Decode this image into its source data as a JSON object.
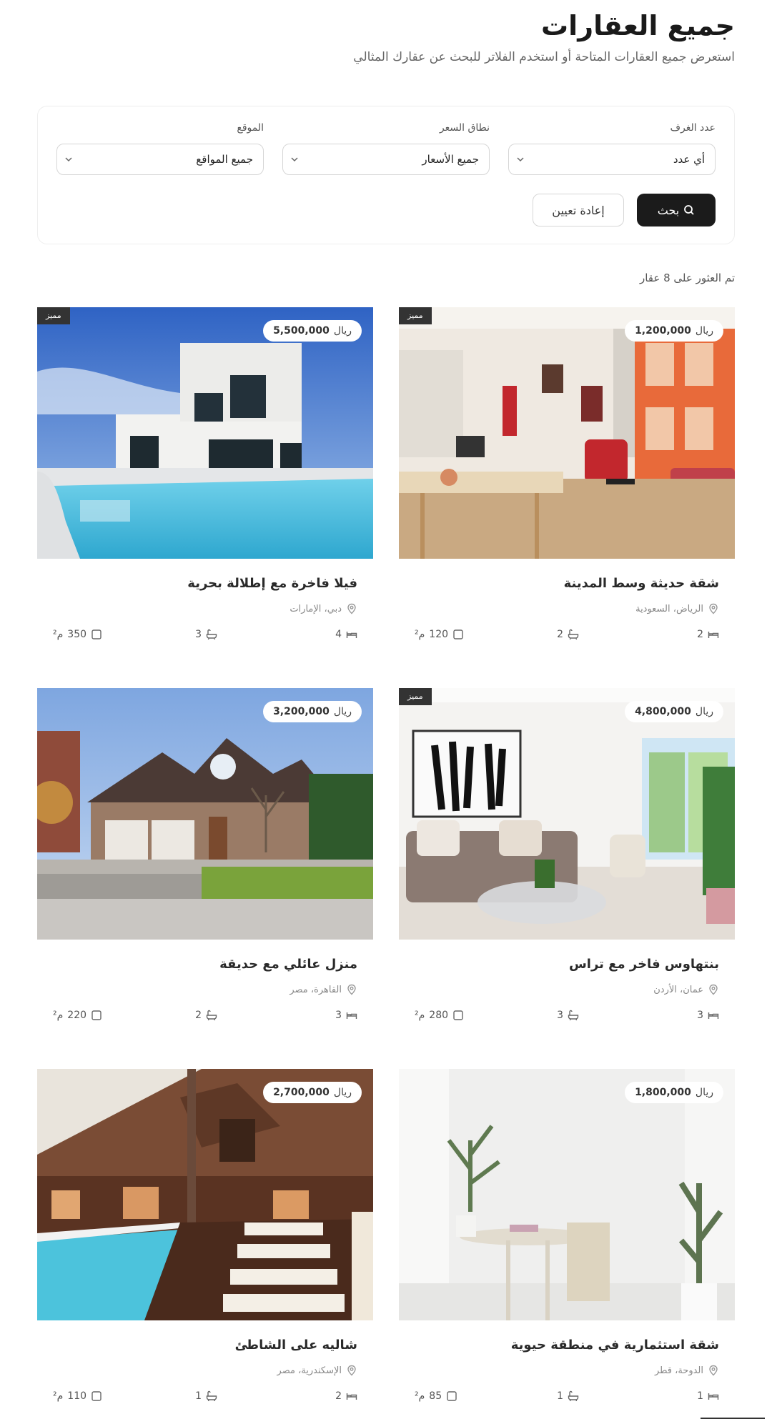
{
  "header": {
    "title": "جميع العقارات",
    "subtitle": "استعرض جميع العقارات المتاحة أو استخدم الفلاتر للبحث عن عقارك المثالي"
  },
  "filters": {
    "rooms": {
      "label": "عدد الغرف",
      "value": "أي عدد"
    },
    "price": {
      "label": "نطاق السعر",
      "value": "جميع الأسعار"
    },
    "location": {
      "label": "الموقع",
      "value": "جميع المواقع"
    },
    "search_label": "بحث",
    "reset_label": "إعادة تعيين"
  },
  "results": {
    "count_text": "تم العثور على 8 عقار"
  },
  "listings": [
    {
      "title": "شقة حديثة وسط المدينة",
      "location": "الرياض، السعودية",
      "price": "1,200,000",
      "currency": "ريال",
      "featured": "مميز",
      "beds": "2",
      "baths": "2",
      "area": "120",
      "unit": "م²"
    },
    {
      "title": "فيلا فاخرة مع إطلالة بحرية",
      "location": "دبي، الإمارات",
      "price": "5,500,000",
      "currency": "ريال",
      "featured": "مميز",
      "beds": "4",
      "baths": "3",
      "area": "350",
      "unit": "م²"
    },
    {
      "title": "بنتهاوس فاخر مع تراس",
      "location": "عمان، الأردن",
      "price": "4,800,000",
      "currency": "ريال",
      "featured": "مميز",
      "beds": "3",
      "baths": "3",
      "area": "280",
      "unit": "م²"
    },
    {
      "title": "منزل عائلي مع حديقة",
      "location": "القاهرة، مصر",
      "price": "3,200,000",
      "currency": "ريال",
      "featured": "",
      "beds": "3",
      "baths": "2",
      "area": "220",
      "unit": "م²"
    },
    {
      "title": "شقة استثمارية في منطقة حيوية",
      "location": "الدوحة، قطر",
      "price": "1,800,000",
      "currency": "ريال",
      "featured": "",
      "beds": "1",
      "baths": "1",
      "area": "85",
      "unit": "م²"
    },
    {
      "title": "شاليه على الشاطئ",
      "location": "الإسكندرية، مصر",
      "price": "2,700,000",
      "currency": "ريال",
      "featured": "",
      "beds": "2",
      "baths": "1",
      "area": "110",
      "unit": "م²"
    }
  ],
  "icons": {
    "search": "search-icon",
    "chevron": "chevron-down-icon",
    "location": "location-pin-icon",
    "bed": "bed-icon",
    "bath": "bath-icon",
    "area": "area-icon"
  },
  "colors": {
    "primary_button": "#1b1b1b",
    "featured_badge": "#333333",
    "border": "#d6d6d6"
  }
}
